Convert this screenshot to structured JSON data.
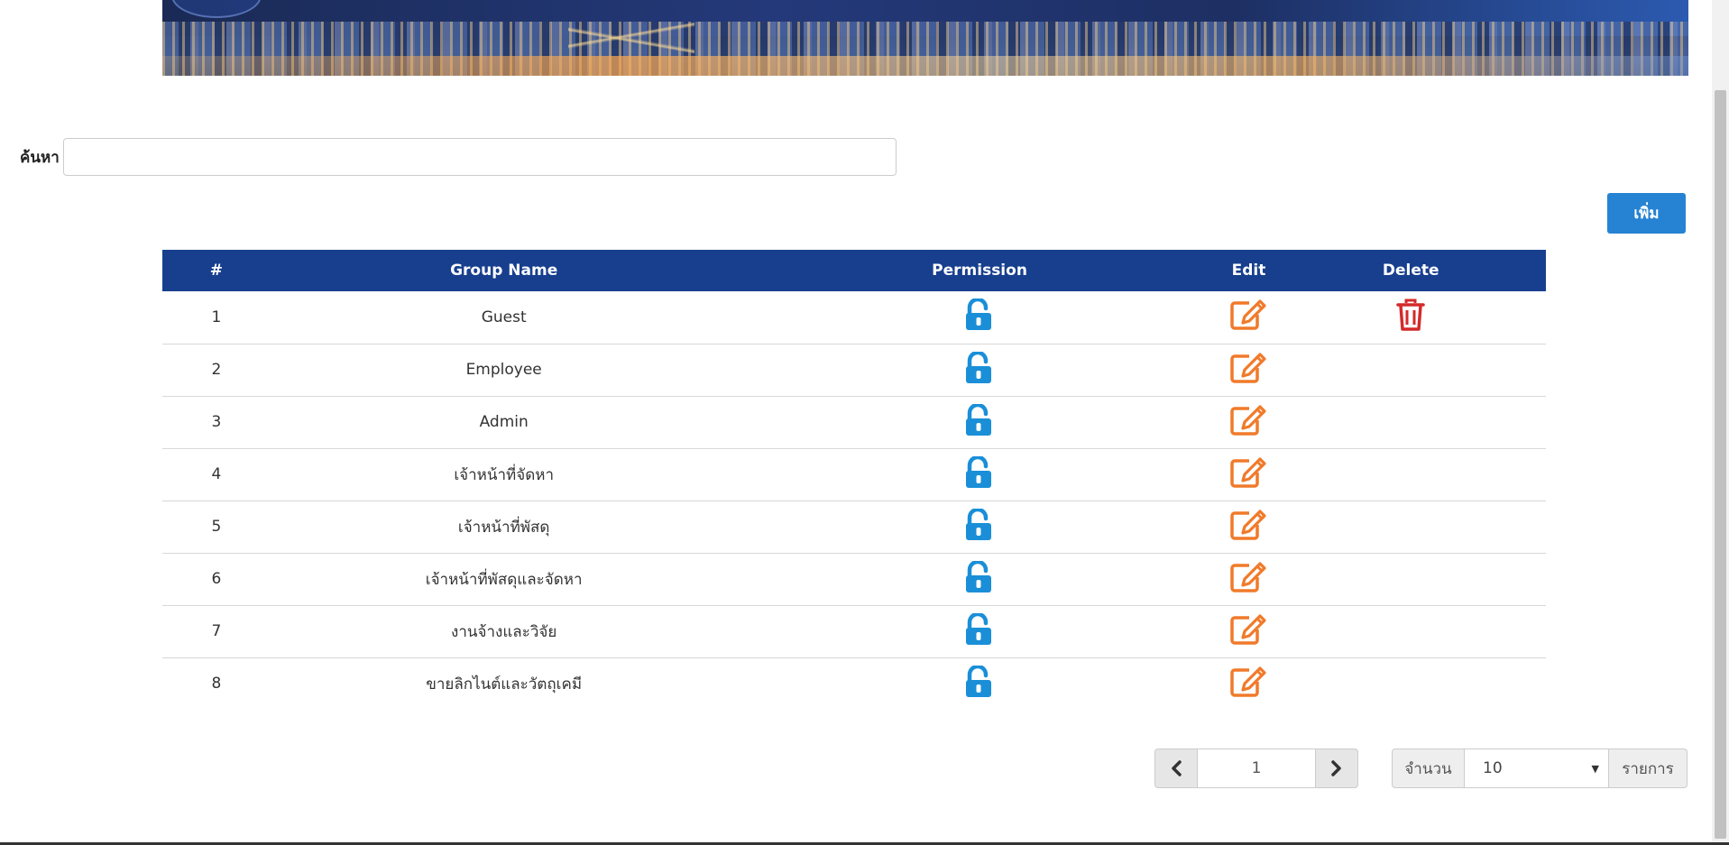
{
  "search": {
    "label": "ค้นหา",
    "value": "",
    "placeholder": ""
  },
  "toolbar": {
    "add_label": "เพิ่ม"
  },
  "table": {
    "headers": {
      "num": "#",
      "group_name": "Group Name",
      "permission": "Permission",
      "edit": "Edit",
      "delete": "Delete"
    },
    "rows": [
      {
        "num": "1",
        "name": "Guest",
        "deletable": true
      },
      {
        "num": "2",
        "name": "Employee",
        "deletable": false
      },
      {
        "num": "3",
        "name": "Admin",
        "deletable": false
      },
      {
        "num": "4",
        "name": "เจ้าหน้าที่จัดหา",
        "deletable": false
      },
      {
        "num": "5",
        "name": "เจ้าหน้าที่พัสดุ",
        "deletable": false
      },
      {
        "num": "6",
        "name": "เจ้าหน้าที่พัสดุและจัดหา",
        "deletable": false
      },
      {
        "num": "7",
        "name": "งานจ้างและวิจัย",
        "deletable": false
      },
      {
        "num": "8",
        "name": "ขายลิกไนต์และวัตถุเคมี",
        "deletable": false
      }
    ],
    "icons": {
      "permission": "unlock-icon",
      "edit": "edit-icon",
      "delete": "trash-icon"
    }
  },
  "pagination": {
    "current_page": "1",
    "prev_icon": "chevron-left-icon",
    "next_icon": "chevron-right-icon"
  },
  "page_size": {
    "prefix_label": "จำนวน",
    "selected": "10",
    "suffix_label": "รายการ"
  },
  "colors": {
    "header_bg": "#173f8e",
    "add_button": "#2683d3",
    "permission_icon": "#1a8fd8",
    "edit_icon": "#f07a2a",
    "delete_icon": "#d42a2a"
  }
}
